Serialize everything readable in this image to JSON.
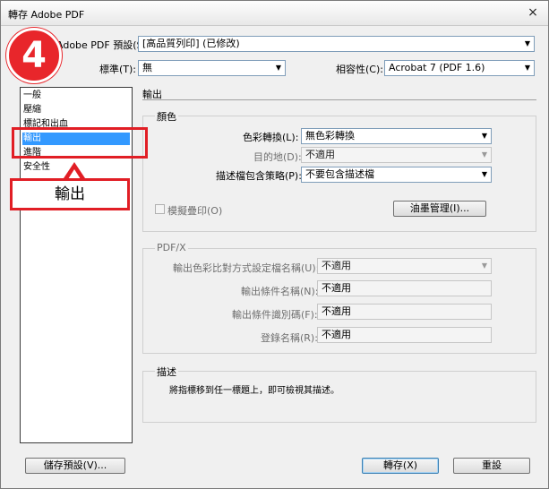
{
  "window": {
    "title": "轉存 Adobe PDF",
    "close_glyph": "×"
  },
  "badge": {
    "number": "4"
  },
  "callout": {
    "text": "輸出"
  },
  "header": {
    "preset_label": "Adobe PDF 預設(S):",
    "preset_value": "[高品質列印] (已修改)",
    "standard_label": "標準(T):",
    "standard_value": "無",
    "compat_label": "相容性(C):",
    "compat_value": "Acrobat 7 (PDF 1.6)"
  },
  "sidebar": {
    "items": [
      {
        "label": "一般"
      },
      {
        "label": "壓縮"
      },
      {
        "label": "標記和出血"
      },
      {
        "label": "輸出"
      },
      {
        "label": "進階"
      },
      {
        "label": "安全性"
      }
    ],
    "selected_index": 3
  },
  "main": {
    "section_title": "輸出",
    "color_group": {
      "title": "顏色",
      "conversion_label": "色彩轉換(L):",
      "conversion_value": "無色彩轉換",
      "destination_label": "目的地(D):",
      "destination_value": "不適用",
      "profile_policy_label": "描述檔包含策略(P):",
      "profile_policy_value": "不要包含描述檔",
      "simulate_overprint_label": "模擬疊印(O)",
      "ink_manager_label": "油墨管理(I)..."
    },
    "pdfx_group": {
      "title": "PDF/X",
      "output_profile_label": "輸出色彩比對方式設定檔名稱(U):",
      "output_profile_value": "不適用",
      "condition_name_label": "輸出條件名稱(N):",
      "condition_name_value": "不適用",
      "condition_id_label": "輸出條件識別碼(F):",
      "condition_id_value": "不適用",
      "registry_label": "登錄名稱(R):",
      "registry_value": "不適用"
    },
    "description_group": {
      "title": "描述",
      "text": "將指標移到任一標題上，即可檢視其描述。"
    }
  },
  "footer": {
    "save_preset_label": "儲存預設(V)...",
    "export_label": "轉存(X)",
    "reset_label": "重設"
  },
  "colors": {
    "badge_red": "#e8262b",
    "highlight_red": "#e11e25",
    "selection_blue": "#3399ff"
  }
}
